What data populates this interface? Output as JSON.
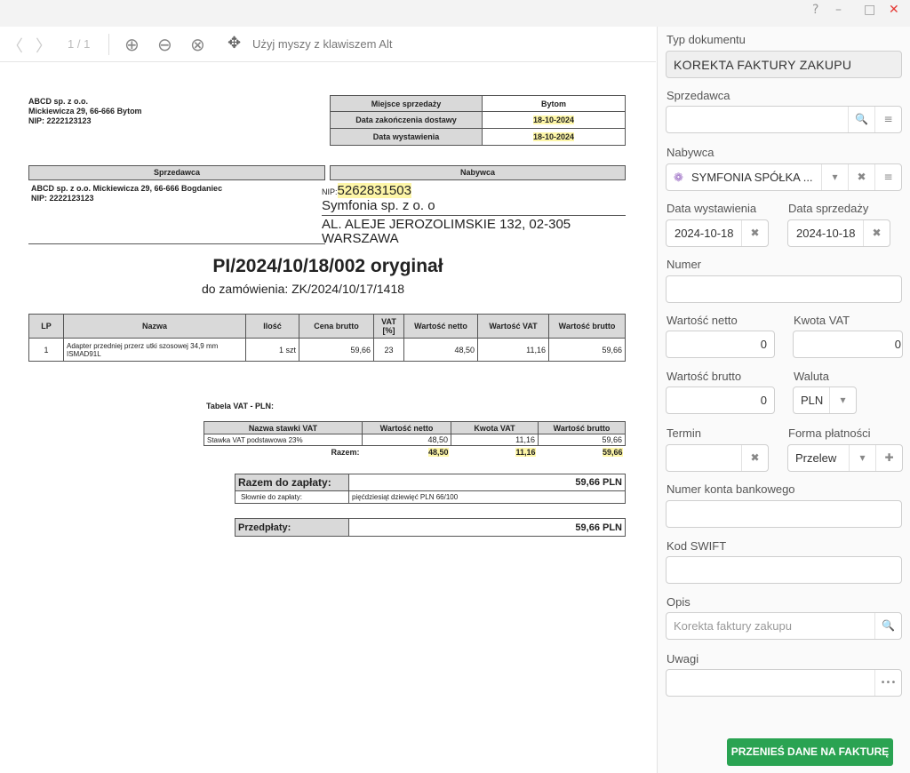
{
  "window": {
    "help": "?",
    "minimize": "–",
    "maximize": "□",
    "close": "✕"
  },
  "viewer": {
    "toolbar": {
      "prev_glyph": "〈",
      "next_glyph": "〉",
      "page_indicator": "1 / 1",
      "zoom_in_glyph": "⊕",
      "zoom_out_glyph": "⊖",
      "zoom_reset_glyph": "⊗",
      "pan_glyph": "✥",
      "pan_hint": "Użyj myszy z klawiszem Alt"
    }
  },
  "invoice": {
    "seller_header": {
      "name": "ABCD sp. z o.o.",
      "address": "Mickiewicza 29, 66-666 Bytom",
      "nip": "NIP: 2222123123"
    },
    "meta": [
      {
        "label": "Miejsce sprzedaży",
        "value": "Bytom"
      },
      {
        "label": "Data zakończenia dostawy",
        "value": "18-10-2024"
      },
      {
        "label": "Data wystawienia",
        "value": "18-10-2024"
      }
    ],
    "seller_box": {
      "title": "Sprzedawca",
      "line1": "ABCD sp. z o.o. Mickiewicza 29, 66-666 Bogdaniec",
      "line2": "NIP: 2222123123"
    },
    "buyer_box": {
      "title": "Nabywca",
      "nip_label": "NIP:",
      "nip": "5262831503",
      "name": "Symfonia sp. z o. o",
      "address1": "AL. ALEJE JEROZOLIMSKIE 132, 02-305",
      "address2": "WARSZAWA"
    },
    "number": "PI/2024/10/18/002 oryginał",
    "order_ref": "do zamówienia: ZK/2024/10/17/1418",
    "items_headers": [
      "LP",
      "Nazwa",
      "Ilość",
      "Cena brutto",
      "VAT [%]",
      "Wartość netto",
      "Wartość VAT",
      "Wartość brutto"
    ],
    "items": [
      {
        "lp": "1",
        "name": "Adapter przedniej przerz utki szosowej 34,9 mm ISMAD91L",
        "qty": "1 szt",
        "price_gross": "59,66",
        "vat": "23",
        "net": "48,50",
        "vat_value": "11,16",
        "gross": "59,66"
      }
    ],
    "vat_table_title": "Tabela VAT - PLN:",
    "vat_headers": [
      "Nazwa stawki VAT",
      "Wartość netto",
      "Kwota VAT",
      "Wartość brutto"
    ],
    "vat_rows": [
      {
        "name": "Stawka VAT podstawowa 23%",
        "net": "48,50",
        "vat": "11,16",
        "gross": "59,66"
      }
    ],
    "vat_total": {
      "label": "Razem:",
      "net": "48,50",
      "vat": "11,16",
      "gross": "59,66"
    },
    "to_pay": {
      "label": "Razem do zapłaty:",
      "value": "59,66 PLN",
      "words_label": "Słownie do zapłaty:",
      "words": "pięćdziesiąt dziewięć PLN 66/100"
    },
    "prepay": {
      "label": "Przedpłaty:",
      "value": "59,66 PLN"
    }
  },
  "panel": {
    "doc_type": {
      "label": "Typ dokumentu",
      "value": "KOREKTA FAKTURY ZAKUPU"
    },
    "seller": {
      "label": "Sprzedawca",
      "value": ""
    },
    "buyer": {
      "label": "Nabywca",
      "value": "SYMFONIA SPÓŁKA ..."
    },
    "issue_date": {
      "label": "Data wystawienia",
      "value": "2024-10-18"
    },
    "sale_date": {
      "label": "Data sprzedaży",
      "value": "2024-10-18"
    },
    "number": {
      "label": "Numer",
      "value": ""
    },
    "net": {
      "label": "Wartość netto",
      "value": "0"
    },
    "vat": {
      "label": "Kwota VAT",
      "value": "0"
    },
    "gross": {
      "label": "Wartość brutto",
      "value": "0"
    },
    "currency": {
      "label": "Waluta",
      "value": "PLN"
    },
    "due": {
      "label": "Termin",
      "value": ""
    },
    "payment_form": {
      "label": "Forma płatności",
      "value": "Przelew"
    },
    "bank_account": {
      "label": "Numer konta bankowego",
      "value": ""
    },
    "swift": {
      "label": "Kod SWIFT",
      "value": ""
    },
    "description": {
      "label": "Opis",
      "placeholder": "Korekta faktury zakupu"
    },
    "notes": {
      "label": "Uwagi",
      "value": ""
    },
    "transfer_button": "PRZENIEŚ DANE NA FAKTURĘ"
  },
  "colors": {
    "accent": "#2aa352",
    "highlight": "#fdf6a8",
    "close": "#e53935"
  }
}
